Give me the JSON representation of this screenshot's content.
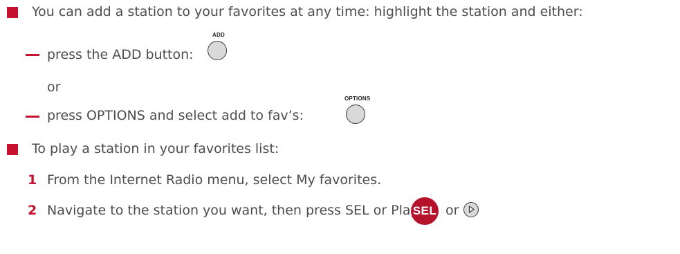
{
  "section_favorites_add": {
    "intro": "You can add a station to your favorites at any time: highlight the station and either:",
    "option_add": "press the ADD button:",
    "add_caption": "ADD",
    "or_label": "or",
    "option_options": "press OPTIONS and select add to fav’s:",
    "options_caption": "OPTIONS"
  },
  "section_play_favorites": {
    "intro": "To play a station in your favorites list:",
    "steps": [
      {
        "number": "1",
        "text": "From the Internet Radio menu, select My favorites."
      },
      {
        "number": "2",
        "text": "Navigate to the station you want, then press SEL or Play:"
      }
    ],
    "sel_label": "SEL",
    "or_label": "or"
  },
  "colors": {
    "accent": "#c4122f",
    "text": "#4d4d4f",
    "button_fill": "#d9d9d9"
  }
}
